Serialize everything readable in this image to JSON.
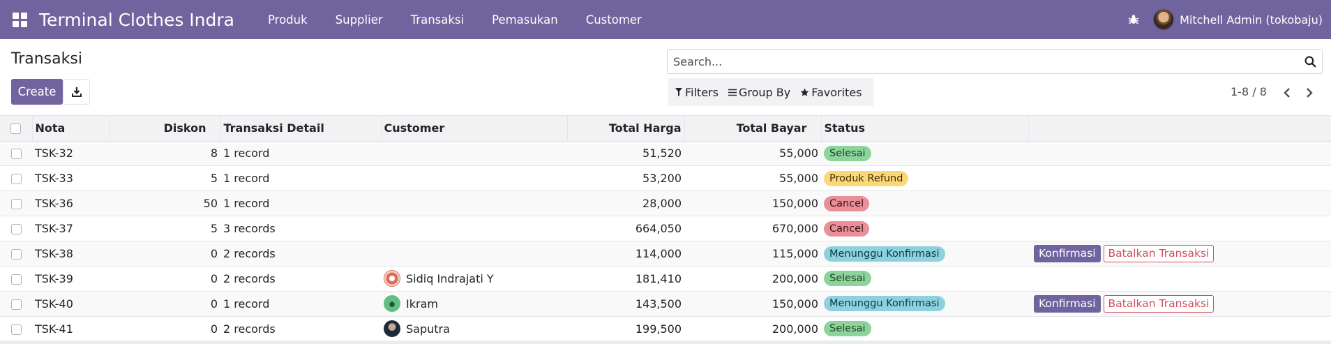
{
  "navbar": {
    "app_name": "Terminal Clothes Indra",
    "menu": [
      "Produk",
      "Supplier",
      "Transaksi",
      "Pemasukan",
      "Customer"
    ],
    "user_name": "Mitchell Admin (tokobaju)"
  },
  "control": {
    "breadcrumb": "Transaksi",
    "create_label": "Create",
    "search_placeholder": "Search...",
    "filters_label": "Filters",
    "groupby_label": "Group By",
    "favorites_label": "Favorites",
    "pager_text": "1-8 / 8"
  },
  "table": {
    "columns": [
      "Nota",
      "Diskon",
      "Transaksi Detail",
      "Customer",
      "Total Harga",
      "Total Bayar",
      "Status"
    ],
    "rows": [
      {
        "nota": "TSK-32",
        "diskon": "8",
        "detail": "1 record",
        "customer": "",
        "total_harga": "51,520",
        "total_bayar": "55,000",
        "status": "Selesai",
        "status_kind": "success",
        "actions": false
      },
      {
        "nota": "TSK-33",
        "diskon": "5",
        "detail": "1 record",
        "customer": "",
        "total_harga": "53,200",
        "total_bayar": "55,000",
        "status": "Produk Refund",
        "status_kind": "warning",
        "actions": false
      },
      {
        "nota": "TSK-36",
        "diskon": "50",
        "detail": "1 record",
        "customer": "",
        "total_harga": "28,000",
        "total_bayar": "150,000",
        "status": "Cancel",
        "status_kind": "danger",
        "actions": false
      },
      {
        "nota": "TSK-37",
        "diskon": "5",
        "detail": "3 records",
        "customer": "",
        "total_harga": "664,050",
        "total_bayar": "670,000",
        "status": "Cancel",
        "status_kind": "danger",
        "actions": false
      },
      {
        "nota": "TSK-38",
        "diskon": "0",
        "detail": "2 records",
        "customer": "",
        "total_harga": "114,000",
        "total_bayar": "115,000",
        "status": "Menunggu Konfirmasi",
        "status_kind": "info",
        "actions": true
      },
      {
        "nota": "TSK-39",
        "diskon": "0",
        "detail": "2 records",
        "customer": "Sidiq Indrajati Y",
        "avatar": "av1",
        "total_harga": "181,410",
        "total_bayar": "200,000",
        "status": "Selesai",
        "status_kind": "success",
        "actions": false
      },
      {
        "nota": "TSK-40",
        "diskon": "0",
        "detail": "1 record",
        "customer": "Ikram",
        "avatar": "av2",
        "total_harga": "143,500",
        "total_bayar": "150,000",
        "status": "Menunggu Konfirmasi",
        "status_kind": "info",
        "actions": true
      },
      {
        "nota": "TSK-41",
        "diskon": "0",
        "detail": "2 records",
        "customer": "Saputra",
        "avatar": "av3",
        "total_harga": "199,500",
        "total_bayar": "200,000",
        "status": "Selesai",
        "status_kind": "success",
        "actions": false
      }
    ],
    "action_confirm": "Konfirmasi",
    "action_cancel": "Batalkan Transaksi"
  },
  "colors": {
    "brand": "#71639e",
    "danger": "#d44c59"
  }
}
